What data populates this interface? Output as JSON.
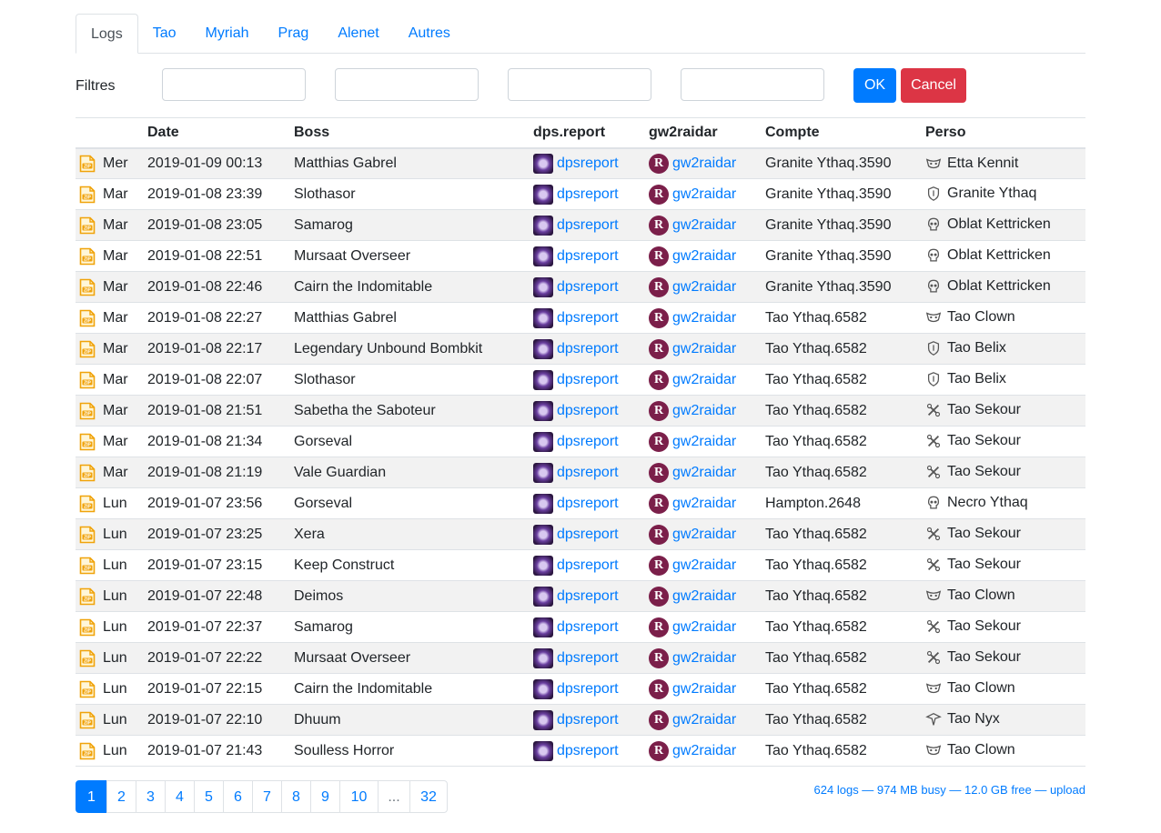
{
  "tabs": [
    "Logs",
    "Tao",
    "Myriah",
    "Prag",
    "Alenet",
    "Autres"
  ],
  "filters": {
    "label": "Filtres",
    "ok_label": "OK",
    "cancel_label": "Cancel"
  },
  "table": {
    "headers": [
      "",
      "Date",
      "Boss",
      "dps.report",
      "gw2raidar",
      "Compte",
      "Perso"
    ],
    "dps_link_text": "dpsreport",
    "raidar_link_text": "gw2raidar",
    "rows": [
      {
        "day": "Mer",
        "date": "2019-01-09 00:13",
        "boss": "Matthias Gabrel",
        "account": "Granite Ythaq.3590",
        "char": "Etta Kennit",
        "icon": "mask-icon"
      },
      {
        "day": "Mar",
        "date": "2019-01-08 23:39",
        "boss": "Slothasor",
        "account": "Granite Ythaq.3590",
        "char": "Granite Ythaq",
        "icon": "shield-icon"
      },
      {
        "day": "Mar",
        "date": "2019-01-08 23:05",
        "boss": "Samarog",
        "account": "Granite Ythaq.3590",
        "char": "Oblat Kettricken",
        "icon": "skull-icon"
      },
      {
        "day": "Mar",
        "date": "2019-01-08 22:51",
        "boss": "Mursaat Overseer",
        "account": "Granite Ythaq.3590",
        "char": "Oblat Kettricken",
        "icon": "skull-icon"
      },
      {
        "day": "Mar",
        "date": "2019-01-08 22:46",
        "boss": "Cairn the Indomitable",
        "account": "Granite Ythaq.3590",
        "char": "Oblat Kettricken",
        "icon": "skull-icon"
      },
      {
        "day": "Mar",
        "date": "2019-01-08 22:27",
        "boss": "Matthias Gabrel",
        "account": "Tao Ythaq.6582",
        "char": "Tao Clown",
        "icon": "mask-icon"
      },
      {
        "day": "Mar",
        "date": "2019-01-08 22:17",
        "boss": "Legendary Unbound Bombkit",
        "account": "Tao Ythaq.6582",
        "char": "Tao Belix",
        "icon": "shield-icon"
      },
      {
        "day": "Mar",
        "date": "2019-01-08 22:07",
        "boss": "Slothasor",
        "account": "Tao Ythaq.6582",
        "char": "Tao Belix",
        "icon": "shield-icon"
      },
      {
        "day": "Mar",
        "date": "2019-01-08 21:51",
        "boss": "Sabetha the Saboteur",
        "account": "Tao Ythaq.6582",
        "char": "Tao Sekour",
        "icon": "gears-icon"
      },
      {
        "day": "Mar",
        "date": "2019-01-08 21:34",
        "boss": "Gorseval",
        "account": "Tao Ythaq.6582",
        "char": "Tao Sekour",
        "icon": "gears-icon"
      },
      {
        "day": "Mar",
        "date": "2019-01-08 21:19",
        "boss": "Vale Guardian",
        "account": "Tao Ythaq.6582",
        "char": "Tao Sekour",
        "icon": "gears-icon"
      },
      {
        "day": "Lun",
        "date": "2019-01-07 23:56",
        "boss": "Gorseval",
        "account": "Hampton.2648",
        "char": "Necro Ythaq",
        "icon": "skull-icon"
      },
      {
        "day": "Lun",
        "date": "2019-01-07 23:25",
        "boss": "Xera",
        "account": "Tao Ythaq.6582",
        "char": "Tao Sekour",
        "icon": "gears-icon"
      },
      {
        "day": "Lun",
        "date": "2019-01-07 23:15",
        "boss": "Keep Construct",
        "account": "Tao Ythaq.6582",
        "char": "Tao Sekour",
        "icon": "gears-icon"
      },
      {
        "day": "Lun",
        "date": "2019-01-07 22:48",
        "boss": "Deimos",
        "account": "Tao Ythaq.6582",
        "char": "Tao Clown",
        "icon": "mask-icon"
      },
      {
        "day": "Lun",
        "date": "2019-01-07 22:37",
        "boss": "Samarog",
        "account": "Tao Ythaq.6582",
        "char": "Tao Sekour",
        "icon": "gears-icon"
      },
      {
        "day": "Lun",
        "date": "2019-01-07 22:22",
        "boss": "Mursaat Overseer",
        "account": "Tao Ythaq.6582",
        "char": "Tao Sekour",
        "icon": "gears-icon"
      },
      {
        "day": "Lun",
        "date": "2019-01-07 22:15",
        "boss": "Cairn the Indomitable",
        "account": "Tao Ythaq.6582",
        "char": "Tao Clown",
        "icon": "mask-icon"
      },
      {
        "day": "Lun",
        "date": "2019-01-07 22:10",
        "boss": "Dhuum",
        "account": "Tao Ythaq.6582",
        "char": "Tao Nyx",
        "icon": "hood-icon"
      },
      {
        "day": "Lun",
        "date": "2019-01-07 21:43",
        "boss": "Soulless Horror",
        "account": "Tao Ythaq.6582",
        "char": "Tao Clown",
        "icon": "mask-icon"
      }
    ]
  },
  "pagination": {
    "pages": [
      "1",
      "2",
      "3",
      "4",
      "5",
      "6",
      "7",
      "8",
      "9",
      "10",
      "...",
      "32"
    ],
    "current": "1"
  },
  "status": "624 logs — 974 MB busy — 12.0 GB free — upload",
  "colors": {
    "accent": "#007bff",
    "danger": "#dc3545",
    "zip": "#f0a30a",
    "raidar": "#7b1f4a"
  }
}
